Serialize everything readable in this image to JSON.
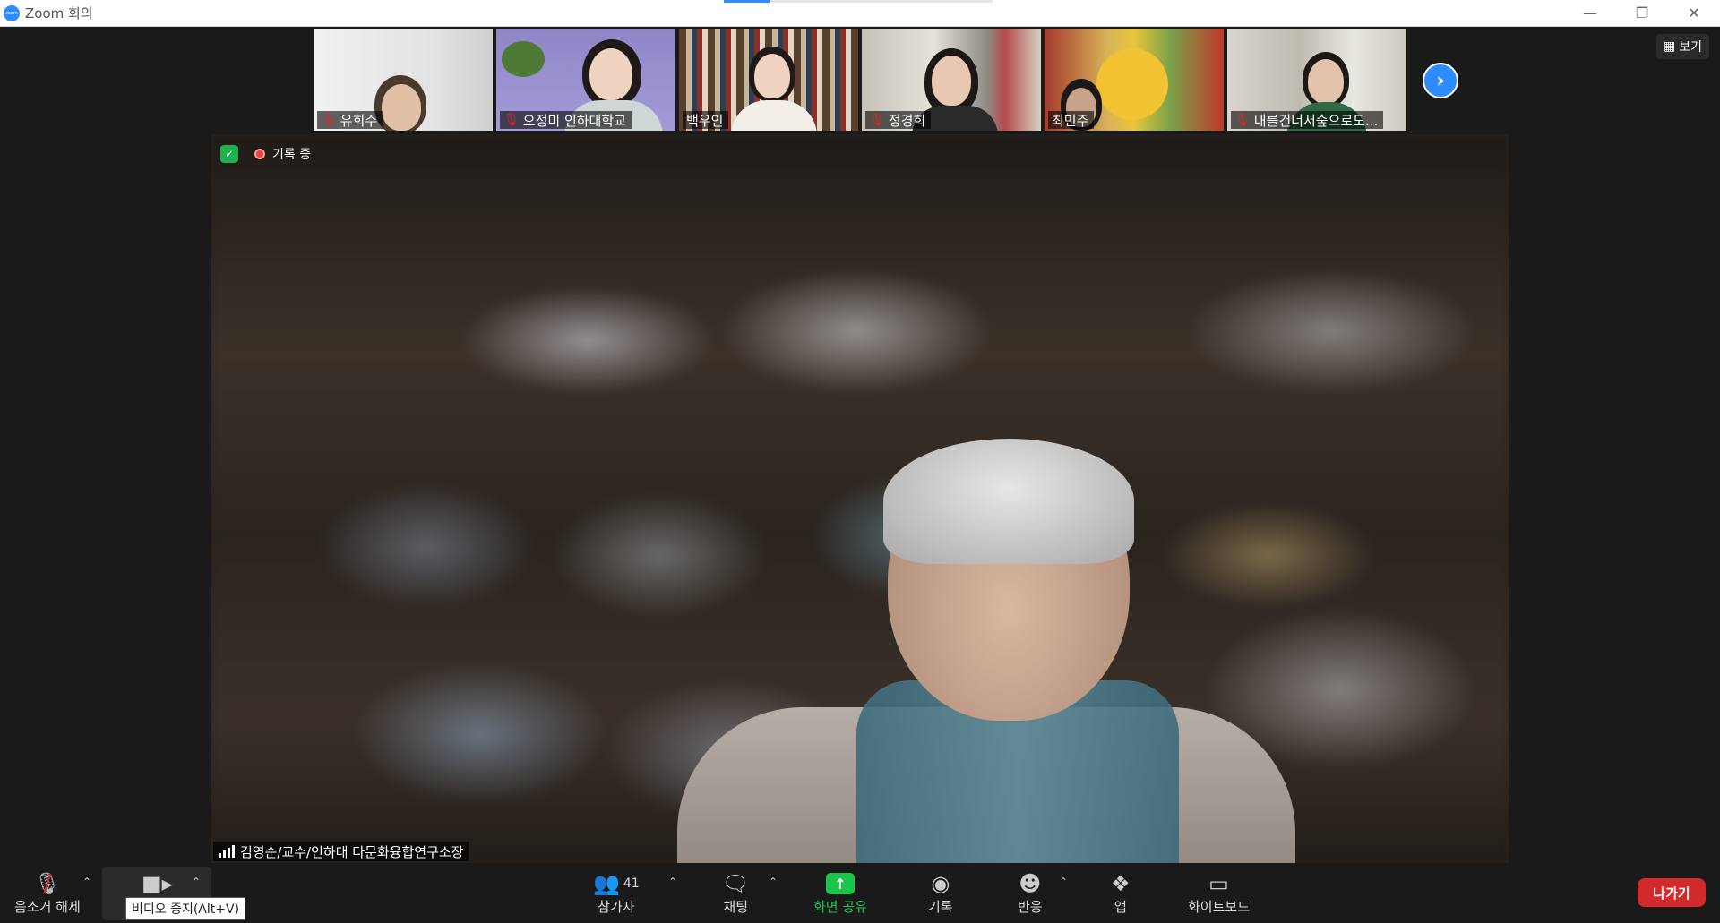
{
  "window": {
    "title": "Zoom 회의",
    "progress_fraction": 0.17
  },
  "top_right": {
    "view_label": "보기"
  },
  "participants_strip": [
    {
      "name": "유희수",
      "muted": true
    },
    {
      "name": "오정미 인하대학교",
      "muted": true
    },
    {
      "name": "백우인",
      "muted": false
    },
    {
      "name": "정경희",
      "muted": true
    },
    {
      "name": "최민주",
      "muted": false
    },
    {
      "name": "내를건너서숲으로도...",
      "muted": true
    }
  ],
  "main_video": {
    "recording_label": "기록 중",
    "speaker_name": "김영순/교수/인하대 다문화융합연구소장"
  },
  "toolbar": {
    "unmute_label": "음소거 해제",
    "video_tooltip": "비디오 중지(Alt+V)",
    "participants_label": "참가자",
    "participants_count": "41",
    "chat_label": "채팅",
    "share_label": "화면 공유",
    "record_label": "기록",
    "reactions_label": "반응",
    "apps_label": "앱",
    "whiteboard_label": "화이트보드",
    "leave_label": "나가기"
  },
  "colors": {
    "accent_blue": "#2d8cff",
    "share_green": "#1bc54a",
    "leave_red": "#d22a2a",
    "muted_red": "#e02828"
  }
}
